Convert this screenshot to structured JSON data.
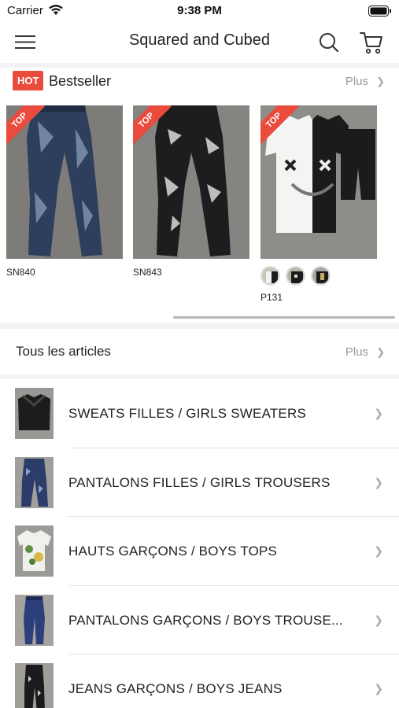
{
  "status_bar": {
    "carrier": "Carrier",
    "time": "9:38 PM"
  },
  "nav": {
    "title": "Squared and Cubed",
    "menu_icon": "hamburger-icon",
    "search_icon": "search-icon",
    "cart_icon": "cart-icon"
  },
  "bestseller": {
    "badge": "HOT",
    "title": "Bestseller",
    "more_label": "Plus",
    "items": [
      {
        "code": "SN840",
        "ribbon": "TOP"
      },
      {
        "code": "SN843",
        "ribbon": "TOP"
      },
      {
        "code": "P131",
        "ribbon": "TOP",
        "swatch_count": 3
      }
    ]
  },
  "all_articles": {
    "title": "Tous les articles",
    "more_label": "Plus"
  },
  "categories": [
    {
      "label": "SWEATS FILLES / GIRLS SWEATERS"
    },
    {
      "label": "PANTALONS FILLES / GIRLS TROUSERS"
    },
    {
      "label": "HAUTS GARÇONS / BOYS TOPS"
    },
    {
      "label": "PANTALONS GARÇONS / BOYS TROUSE..."
    },
    {
      "label": "JEANS GARÇONS / BOYS JEANS"
    }
  ],
  "colors": {
    "accent_red": "#e94b3c",
    "muted_text": "#999999",
    "separator": "#f3f3f3"
  }
}
